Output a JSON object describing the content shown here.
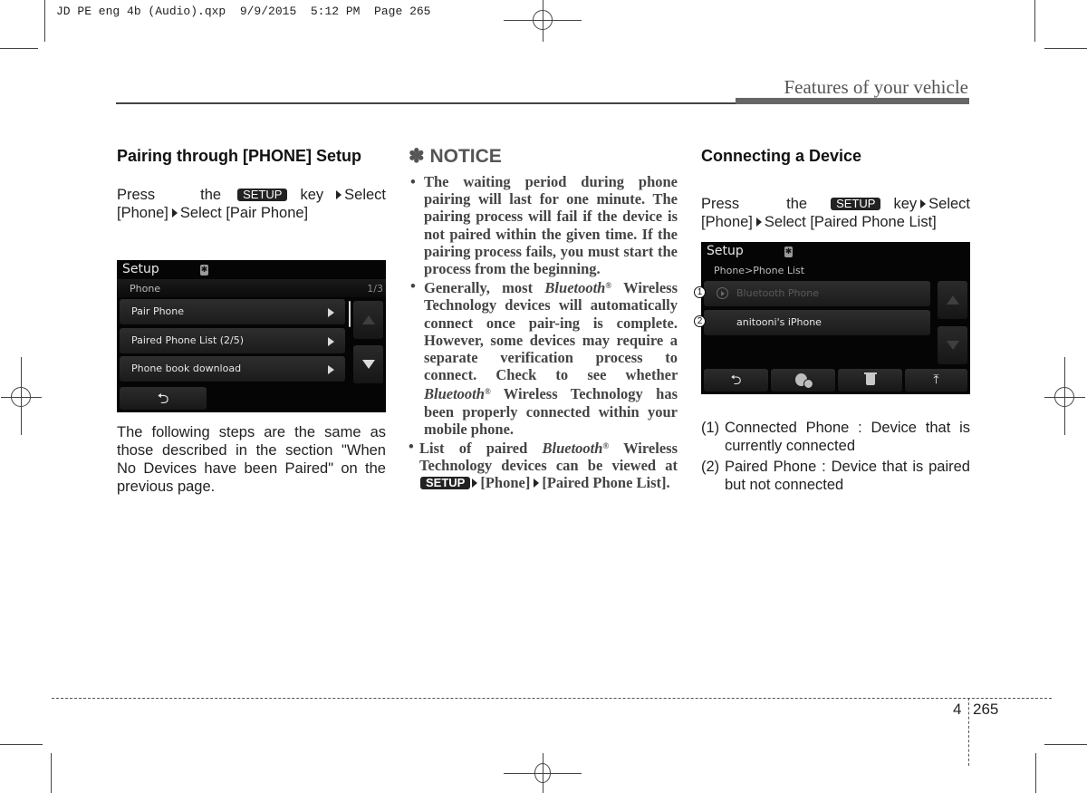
{
  "slug_line": "JD PE eng 4b (Audio).qxp  9/9/2015  5:12 PM  Page 265",
  "running_head": "Features of your vehicle",
  "footer": {
    "chapter": "4",
    "page": "265"
  },
  "key_label": "SETUP",
  "left_column": {
    "heading": "Pairing through [PHONE] Setup",
    "instruction": {
      "press": "Press the",
      "key_word": "key",
      "step1": "Select [Phone]",
      "step2": "Select [Pair Phone]"
    },
    "screen": {
      "title": "Setup",
      "bt_icon": "bluetooth-icon",
      "subtitle": "Phone",
      "page_indicator": "1/3",
      "items": [
        {
          "label": "Pair Phone"
        },
        {
          "label": "Paired Phone List  (2/5)"
        },
        {
          "label": "Phone book download"
        }
      ],
      "back_icon": "back-arrow-icon"
    },
    "note": "The following steps are the same as those described in the section \"When No Devices have been Paired\" on the previous page."
  },
  "notice": {
    "symbol": "✽",
    "title": "NOTICE",
    "items": [
      {
        "text": "The waiting period during phone pairing will last for one minute. The pairing process will fail if the device is not paired within the given time. If the pairing process fails, you must start the process from the beginning."
      },
      {
        "pre": "Generally, most",
        "brand": "Bluetooth",
        "reg": "®",
        "post": "Wireless Technology devices will automatically connect once pair-ing is complete. However, some devices may require a separate verification process to connect. Check to see whether",
        "brand2": "Bluetooth",
        "post2": "Wireless Technology has been properly connected within your mobile phone."
      },
      {
        "pre": "List of paired",
        "brand": "Bluetooth",
        "post": "Wireless Technology devices can be viewed at",
        "path1": "[Phone]",
        "path2": "[Paired Phone List]."
      }
    ]
  },
  "right_column": {
    "heading": "Connecting a Device",
    "instruction": {
      "press": "Press the",
      "key_word": "key",
      "step1": "Select [Phone]",
      "step2": "Select [Paired Phone List]"
    },
    "screen": {
      "title": "Setup",
      "breadcrumb": "Phone>Phone List",
      "devices": [
        {
          "callout": "1",
          "label": "Bluetooth Phone",
          "state": "connected"
        },
        {
          "callout": "2",
          "label": "anitooni's iPhone",
          "state": "paired"
        }
      ],
      "bottom_buttons": [
        {
          "icon": "back-arrow-icon"
        },
        {
          "icon": "bluetooth-connect-icon"
        },
        {
          "icon": "trash-icon"
        },
        {
          "icon": "move-to-top-icon"
        }
      ]
    },
    "definitions": [
      {
        "num": "(1)",
        "text": "Connected Phone : Device that is currently connected"
      },
      {
        "num": "(2)",
        "text": "Paired Phone : Device that is paired but not connected"
      }
    ]
  }
}
